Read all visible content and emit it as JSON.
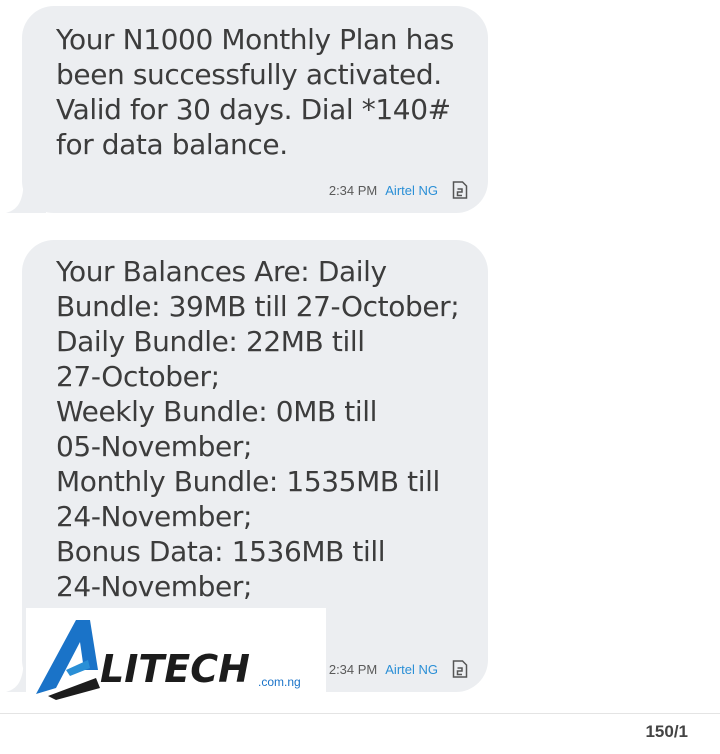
{
  "messages": [
    {
      "text": "Your N1000 Monthly Plan has\nbeen successfully activated.\nValid for 30 days. Dial *140#\nfor data balance.",
      "time": "2:34 PM",
      "sender": "Airtel NG",
      "sim_icon": "sim-card-2-icon"
    },
    {
      "text": "Your Balances Are: Daily\nBundle: 39MB till 27-October;\nDaily Bundle: 22MB till\n27-October;\nWeekly Bundle: 0MB till\n05-November;\nMonthly Bundle: 1535MB till\n24-November;\nBonus Data: 1536MB till\n24-November;",
      "time": "2:34 PM",
      "sender": "Airtel NG",
      "sim_icon": "sim-card-2-icon"
    }
  ],
  "watermark": {
    "brand": "LITECH",
    "domain": ".com.ng",
    "color_primary": "#1a73c8",
    "color_text": "#1c1c1c"
  },
  "footer": {
    "char_counter": "150/1"
  },
  "colors": {
    "bubble_bg": "#eceef1",
    "text": "#3c3c3c",
    "sender": "#2a8fd6"
  }
}
